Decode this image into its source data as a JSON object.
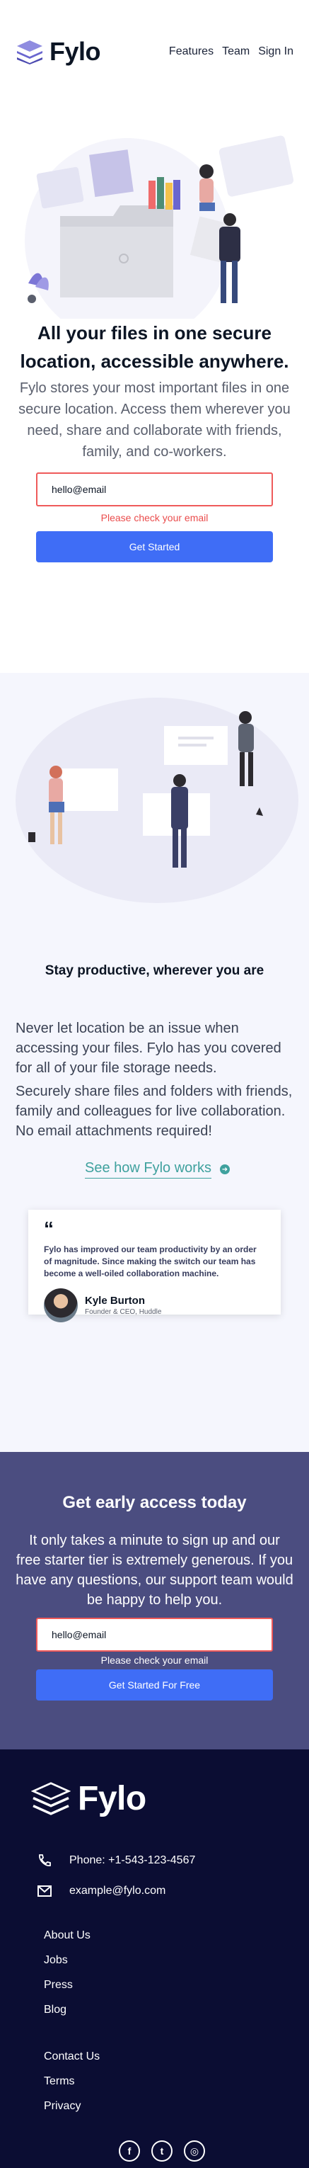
{
  "header": {
    "logo_text": "Fylo",
    "nav": [
      "Features",
      "Team",
      "Sign In"
    ]
  },
  "hero": {
    "title": "All your files in one secure location, accessible anywhere.",
    "description": "Fylo stores your most important files in one secure location. Access them wherever you need, share and collaborate with friends, family, and co-workers.",
    "email_value": "hello@email",
    "error": "Please check your email",
    "button": "Get Started"
  },
  "productive": {
    "title": "Stay productive, wherever you are",
    "p1": "Never let location be an issue when accessing your files. Fylo has you covered for all of your file storage needs.",
    "p2": "Securely share files and folders with friends, family and colleagues for live collaboration. No email attachments required!",
    "link": "See how Fylo works",
    "testimonial": {
      "quote_mark": "“",
      "text": "Fylo has improved our team productivity by an order of magnitude. Since making the switch our team has become a well-oiled collaboration machine.",
      "name": "Kyle Burton",
      "role": "Founder & CEO, Huddle"
    }
  },
  "early": {
    "title": "Get early access today",
    "description": "It only takes a minute to sign up and our free starter tier is extremely generous. If you have any questions, our support team would be happy to help you.",
    "email_value": "hello@email",
    "error": "Please check your email",
    "button": "Get Started For Free"
  },
  "footer": {
    "logo_text": "Fylo",
    "phone": "Phone: +1-543-123-4567",
    "email": "example@fylo.com",
    "links1": [
      "About Us",
      "Jobs",
      "Press",
      "Blog"
    ],
    "links2": [
      "Contact Us",
      "Terms",
      "Privacy"
    ],
    "socials": [
      {
        "icon": "facebook-icon",
        "glyph": "f"
      },
      {
        "icon": "twitter-icon",
        "glyph": "t"
      },
      {
        "icon": "instagram-icon",
        "glyph": "◎"
      }
    ]
  },
  "colors": {
    "accent_blue": "#3f6df6",
    "error_red": "#ea4c4c",
    "teal_link": "#3fa19e",
    "early_bg": "#4b4d80",
    "footer_bg": "#0b0d33"
  }
}
